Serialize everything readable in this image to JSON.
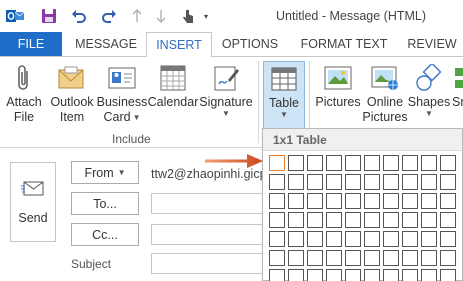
{
  "window": {
    "title": "Untitled - Message (HTML)"
  },
  "quick_access": [
    "outlook-icon",
    "save-icon",
    "undo-icon",
    "redo-icon",
    "up-arrow-icon",
    "down-arrow-icon",
    "touch-mode-icon",
    "customize-caret-icon"
  ],
  "tabs": {
    "file": "FILE",
    "items": [
      "MESSAGE",
      "INSERT",
      "OPTIONS",
      "FORMAT TEXT",
      "REVIEW"
    ],
    "active": "INSERT"
  },
  "ribbon": {
    "include_group": {
      "label": "Include",
      "buttons": [
        {
          "line1": "Attach",
          "line2": "File"
        },
        {
          "line1": "Outlook",
          "line2": "Item"
        },
        {
          "line1": "Business",
          "line2": "Card"
        },
        {
          "line1": "Calendar",
          "line2": ""
        },
        {
          "line1": "Signature",
          "line2": ""
        }
      ]
    },
    "table_button": {
      "label": "Table"
    },
    "illustrations": [
      {
        "line1": "Pictures",
        "line2": ""
      },
      {
        "line1": "Online",
        "line2": "Pictures"
      },
      {
        "line1": "Shapes",
        "line2": ""
      },
      {
        "line1": "Sm",
        "line2": ""
      }
    ]
  },
  "compose": {
    "send_label": "Send",
    "from_label": "From",
    "from_address": "ttw2@zhaopinhi.gicp",
    "to_label": "To...",
    "cc_label": "Cc...",
    "subject_label": "Subject"
  },
  "table_picker": {
    "header": "1x1 Table",
    "columns": 10,
    "rows": 7,
    "selected_cols": 1,
    "selected_rows": 1
  },
  "colors": {
    "file_tab": "#1e6ec8",
    "active_tab_text": "#2f6fbf",
    "table_highlight": "#cde3f6",
    "arrow": "#d0592c",
    "selected_cell": "#e57d2c"
  }
}
